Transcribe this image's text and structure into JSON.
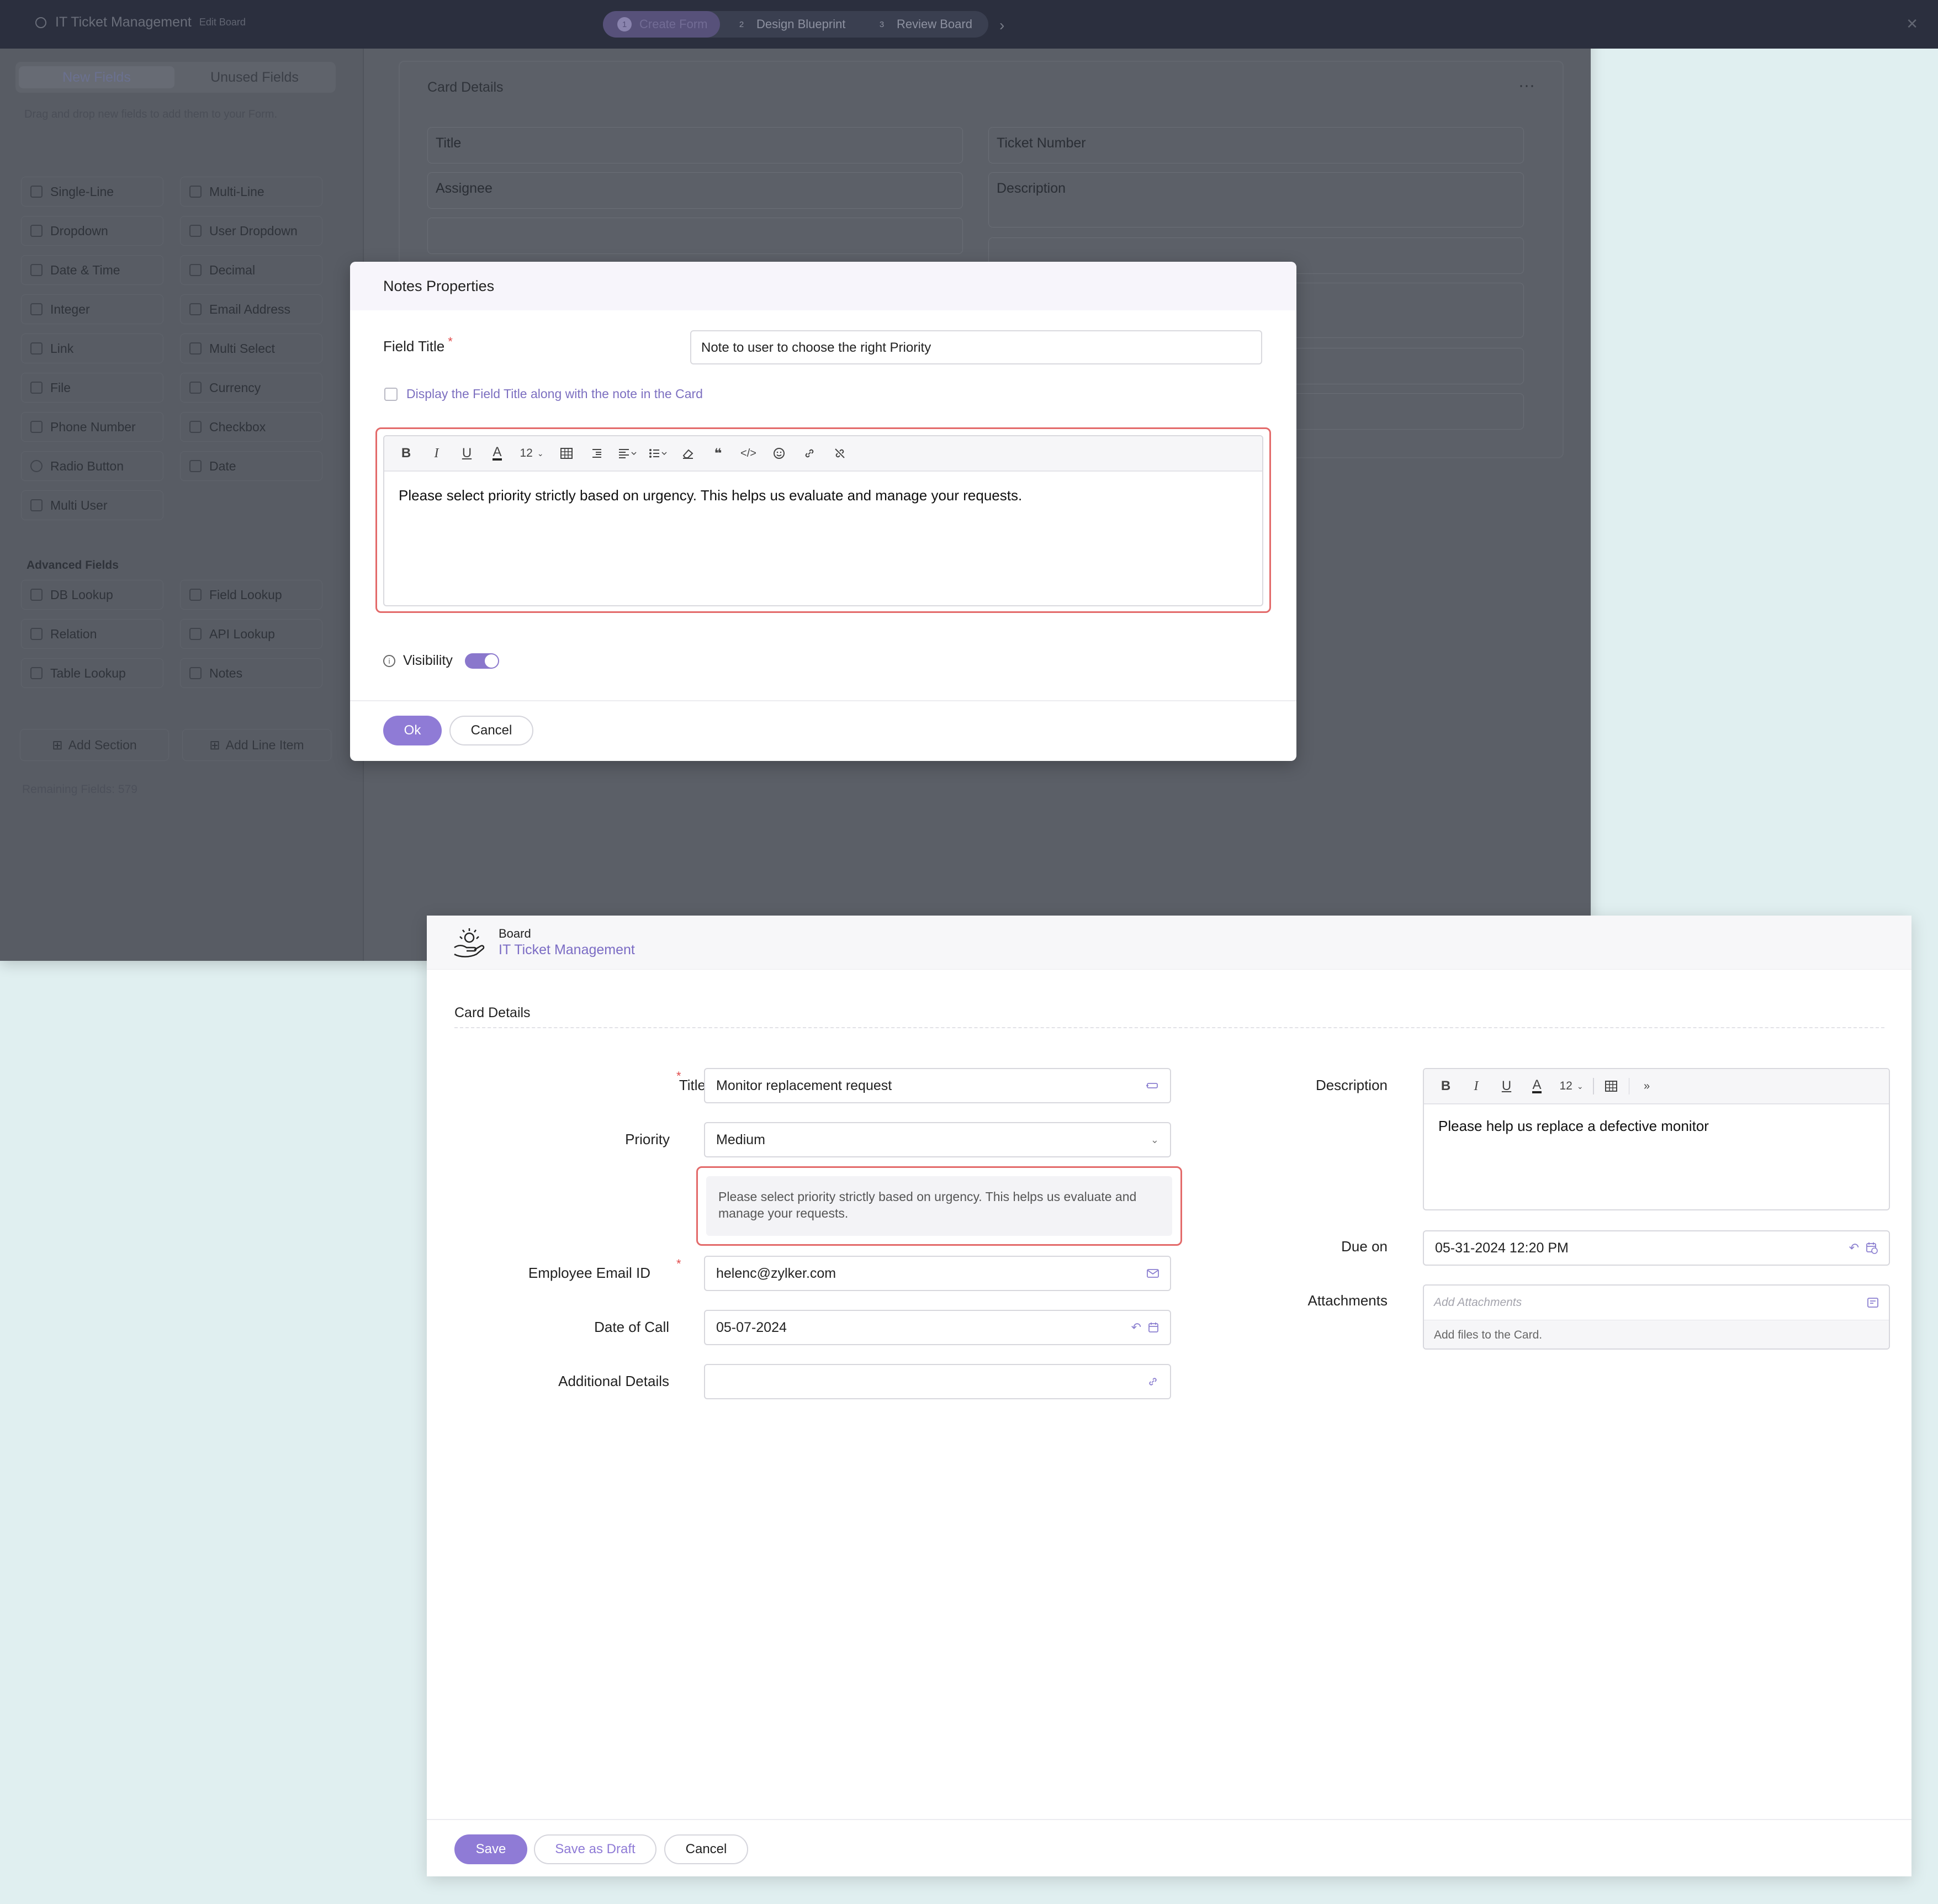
{
  "builder": {
    "app_title": "IT Ticket Management",
    "app_subtitle": "Edit Board",
    "steps": [
      {
        "num": "1",
        "label": "Create Form"
      },
      {
        "num": "2",
        "label": "Design Blueprint"
      },
      {
        "num": "3",
        "label": "Review Board"
      }
    ],
    "tabs": [
      "New Fields",
      "Unused Fields"
    ],
    "hint": "Drag and drop new fields to add them to your Form.",
    "fields_left": [
      "Single-Line",
      "Dropdown",
      "Date & Time",
      "Integer",
      "Link",
      "File",
      "Phone Number",
      "Radio Button",
      "Multi User"
    ],
    "fields_right": [
      "Multi-Line",
      "User Dropdown",
      "Decimal",
      "Email Address",
      "Multi Select",
      "Currency",
      "Checkbox",
      "Date"
    ],
    "advanced_heading": "Advanced Fields",
    "advanced_left": [
      "DB Lookup",
      "Relation",
      "Table Lookup"
    ],
    "advanced_right": [
      "Field Lookup",
      "API Lookup",
      "Notes"
    ],
    "add_section": "Add Section",
    "add_line_item": "Add Line Item",
    "remaining": "Remaining Fields: 579",
    "card_title": "Card Details",
    "card_fields": [
      "Title",
      "Assignee",
      "Ticket Number",
      "Description"
    ]
  },
  "modal": {
    "title": "Notes Properties",
    "field_title_label": "Field Title",
    "field_title_value": "Note to user to choose the right Priority",
    "display_checkbox_label": "Display the Field Title along with the note in the Card",
    "font_size": "12",
    "note_text": "Please select priority strictly based on urgency. This helps us evaluate and manage your requests.",
    "visibility_label": "Visibility",
    "ok": "Ok",
    "cancel": "Cancel"
  },
  "card_form": {
    "board_label": "Board",
    "board_name": "IT Ticket Management",
    "section_title": "Card Details",
    "title_label": "Title",
    "title_value": "Monitor replacement request",
    "priority_label": "Priority",
    "priority_value": "Medium",
    "priority_note": "Please select priority strictly based on urgency. This helps us evaluate and manage your requests.",
    "email_label": "Employee Email ID",
    "email_value": "helenc@zylker.com",
    "date_of_call_label": "Date of Call",
    "date_of_call_value": "05-07-2024",
    "additional_label": "Additional Details",
    "description_label": "Description",
    "description_font_size": "12",
    "description_value": "Please help us replace a defective monitor",
    "due_label": "Due on",
    "due_value": "05-31-2024 12:20 PM",
    "attachments_label": "Attachments",
    "attachments_placeholder": "Add Attachments",
    "attachments_hint": "Add files to the Card.",
    "save": "Save",
    "save_draft": "Save as Draft",
    "cancel": "Cancel"
  },
  "colors": {
    "accent": "#8f7bd6",
    "highlight": "#e36a6a",
    "background": "#e0eff0"
  }
}
